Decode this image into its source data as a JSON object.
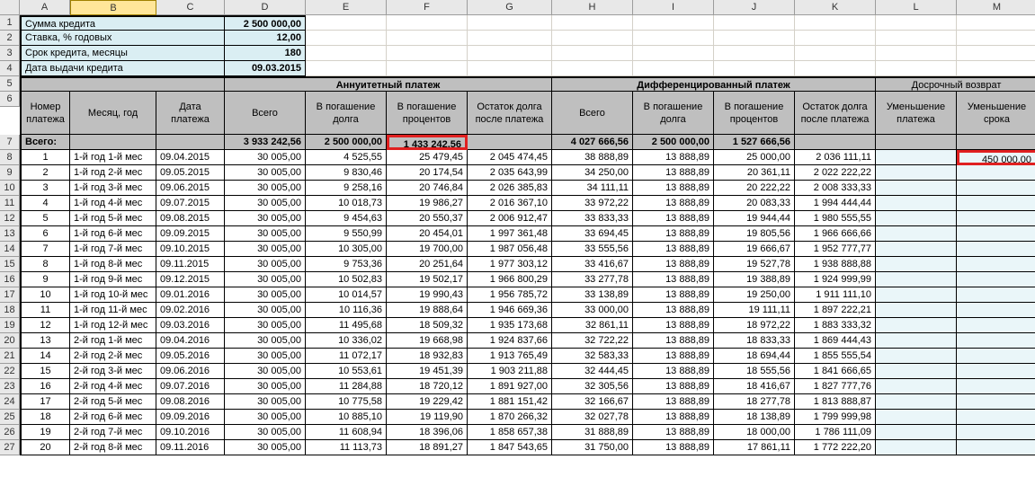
{
  "colhdr": [
    "",
    "A",
    "B",
    "C",
    "D",
    "E",
    "F",
    "G",
    "H",
    "I",
    "J",
    "K",
    "L",
    "M"
  ],
  "params": {
    "sum_label": "Сумма кредита",
    "sum": "2 500 000,00",
    "rate_label": "Ставка, % годовых",
    "rate": "12,00",
    "term_label": "Срок кредита, месяцы",
    "term": "180",
    "date_label": "Дата выдачи кредита",
    "date": "09.03.2015"
  },
  "group": {
    "ann": "Аннуитетный платеж",
    "diff": "Дифференцированный платеж",
    "early": "Досрочный возврат"
  },
  "h": {
    "num": "Номер платежа",
    "month": "Месяц, год",
    "pdate": "Дата платежа",
    "total": "Всего",
    "principal": "В погашение долга",
    "interest": "В погашение процентов",
    "balance": "Остаток долга после платежа",
    "dprincipal": "В погашение долга",
    "dinterest": "В погашение процентов",
    "dbalance": "Остаток долга после платежа",
    "reduce_pay": "Уменьшение платежа",
    "reduce_term": "Уменьшение срока"
  },
  "totals_row_label": "Всего:",
  "totals": {
    "ann_total": "3 933 242,56",
    "ann_principal": "2 500 000,00",
    "ann_interest": "1 433 242,56",
    "diff_total": "4 027 666,56",
    "diff_principal": "2 500 000,00",
    "diff_interest": "1 527 666,56"
  },
  "early_payment": "450 000,00",
  "chart_data": {
    "type": "table",
    "columns": [
      "n",
      "month",
      "date",
      "a_total",
      "a_principal",
      "a_interest",
      "a_balance",
      "d_total",
      "d_principal",
      "d_interest",
      "d_balance"
    ],
    "rows": [
      [
        "1",
        "1-й год 1-й мес",
        "09.04.2015",
        "30 005,00",
        "4 525,55",
        "25 479,45",
        "2 045 474,45",
        "38 888,89",
        "13 888,89",
        "25 000,00",
        "2 036 111,11"
      ],
      [
        "2",
        "1-й год 2-й мес",
        "09.05.2015",
        "30 005,00",
        "9 830,46",
        "20 174,54",
        "2 035 643,99",
        "34 250,00",
        "13 888,89",
        "20 361,11",
        "2 022 222,22"
      ],
      [
        "3",
        "1-й год 3-й мес",
        "09.06.2015",
        "30 005,00",
        "9 258,16",
        "20 746,84",
        "2 026 385,83",
        "34 111,11",
        "13 888,89",
        "20 222,22",
        "2 008 333,33"
      ],
      [
        "4",
        "1-й год 4-й мес",
        "09.07.2015",
        "30 005,00",
        "10 018,73",
        "19 986,27",
        "2 016 367,10",
        "33 972,22",
        "13 888,89",
        "20 083,33",
        "1 994 444,44"
      ],
      [
        "5",
        "1-й год 5-й мес",
        "09.08.2015",
        "30 005,00",
        "9 454,63",
        "20 550,37",
        "2 006 912,47",
        "33 833,33",
        "13 888,89",
        "19 944,44",
        "1 980 555,55"
      ],
      [
        "6",
        "1-й год 6-й мес",
        "09.09.2015",
        "30 005,00",
        "9 550,99",
        "20 454,01",
        "1 997 361,48",
        "33 694,45",
        "13 888,89",
        "19 805,56",
        "1 966 666,66"
      ],
      [
        "7",
        "1-й год 7-й мес",
        "09.10.2015",
        "30 005,00",
        "10 305,00",
        "19 700,00",
        "1 987 056,48",
        "33 555,56",
        "13 888,89",
        "19 666,67",
        "1 952 777,77"
      ],
      [
        "8",
        "1-й год 8-й мес",
        "09.11.2015",
        "30 005,00",
        "9 753,36",
        "20 251,64",
        "1 977 303,12",
        "33 416,67",
        "13 888,89",
        "19 527,78",
        "1 938 888,88"
      ],
      [
        "9",
        "1-й год 9-й мес",
        "09.12.2015",
        "30 005,00",
        "10 502,83",
        "19 502,17",
        "1 966 800,29",
        "33 277,78",
        "13 888,89",
        "19 388,89",
        "1 924 999,99"
      ],
      [
        "10",
        "1-й год 10-й мес",
        "09.01.2016",
        "30 005,00",
        "10 014,57",
        "19 990,43",
        "1 956 785,72",
        "33 138,89",
        "13 888,89",
        "19 250,00",
        "1 911 111,10"
      ],
      [
        "11",
        "1-й год 11-й мес",
        "09.02.2016",
        "30 005,00",
        "10 116,36",
        "19 888,64",
        "1 946 669,36",
        "33 000,00",
        "13 888,89",
        "19 111,11",
        "1 897 222,21"
      ],
      [
        "12",
        "1-й год 12-й мес",
        "09.03.2016",
        "30 005,00",
        "11 495,68",
        "18 509,32",
        "1 935 173,68",
        "32 861,11",
        "13 888,89",
        "18 972,22",
        "1 883 333,32"
      ],
      [
        "13",
        "2-й год 1-й мес",
        "09.04.2016",
        "30 005,00",
        "10 336,02",
        "19 668,98",
        "1 924 837,66",
        "32 722,22",
        "13 888,89",
        "18 833,33",
        "1 869 444,43"
      ],
      [
        "14",
        "2-й год 2-й мес",
        "09.05.2016",
        "30 005,00",
        "11 072,17",
        "18 932,83",
        "1 913 765,49",
        "32 583,33",
        "13 888,89",
        "18 694,44",
        "1 855 555,54"
      ],
      [
        "15",
        "2-й год 3-й мес",
        "09.06.2016",
        "30 005,00",
        "10 553,61",
        "19 451,39",
        "1 903 211,88",
        "32 444,45",
        "13 888,89",
        "18 555,56",
        "1 841 666,65"
      ],
      [
        "16",
        "2-й год 4-й мес",
        "09.07.2016",
        "30 005,00",
        "11 284,88",
        "18 720,12",
        "1 891 927,00",
        "32 305,56",
        "13 888,89",
        "18 416,67",
        "1 827 777,76"
      ],
      [
        "17",
        "2-й год 5-й мес",
        "09.08.2016",
        "30 005,00",
        "10 775,58",
        "19 229,42",
        "1 881 151,42",
        "32 166,67",
        "13 888,89",
        "18 277,78",
        "1 813 888,87"
      ],
      [
        "18",
        "2-й год 6-й мес",
        "09.09.2016",
        "30 005,00",
        "10 885,10",
        "19 119,90",
        "1 870 266,32",
        "32 027,78",
        "13 888,89",
        "18 138,89",
        "1 799 999,98"
      ],
      [
        "19",
        "2-й год 7-й мес",
        "09.10.2016",
        "30 005,00",
        "11 608,94",
        "18 396,06",
        "1 858 657,38",
        "31 888,89",
        "13 888,89",
        "18 000,00",
        "1 786 111,09"
      ],
      [
        "20",
        "2-й год 8-й мес",
        "09.11.2016",
        "30 005,00",
        "11 113,73",
        "18 891,27",
        "1 847 543,65",
        "31 750,00",
        "13 888,89",
        "17 861,11",
        "1 772 222,20"
      ]
    ]
  },
  "rownums_start": 1
}
